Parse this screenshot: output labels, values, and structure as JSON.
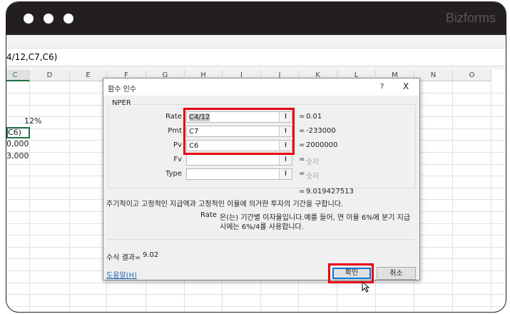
{
  "window": {
    "brand": "Bizforms"
  },
  "formula_bar": {
    "text": "4/12,C7,C6)"
  },
  "columns": [
    "C",
    "D",
    "E",
    "F",
    "G",
    "H",
    "I",
    "J",
    "K",
    "L",
    "M",
    "N",
    "O"
  ],
  "cells": [
    "12%",
    "C6)",
    "0,000",
    "3,000"
  ],
  "dialog": {
    "title": "함수 인수",
    "help": "?",
    "close": "X",
    "function_name": "NPER",
    "args": [
      {
        "label": "Rate",
        "value": "C4/12",
        "result": "0.01"
      },
      {
        "label": "Pmt",
        "value": "C7",
        "result": "-233000"
      },
      {
        "label": "Pv",
        "value": "C6",
        "result": "2000000"
      },
      {
        "label": "Fv",
        "value": "",
        "result": "숫자"
      },
      {
        "label": "Type",
        "value": "",
        "result": "숫자"
      }
    ],
    "equals": "=",
    "up_arrow": "⭱",
    "total_result": "9.019427513",
    "description": "주기적이고 고정적인 지급액과 고정적인 이율에 의거한 투자의 기간을 구합니다.",
    "arg_help_name": "Rate",
    "arg_help_line1": "은(는) 기간별 이자율입니다.예를 들어, 연 이율 6%에 분기 지급",
    "arg_help_line2": "시에는 6%/4를 사용합니다.",
    "formula_result_label": "수식 결과=",
    "formula_result": "9.02",
    "help_link": "도움말(H)",
    "ok": "확인",
    "cancel": "취소"
  }
}
